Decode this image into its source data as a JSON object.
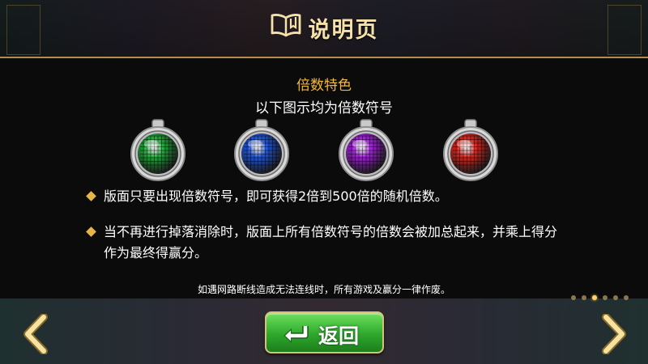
{
  "header": {
    "title": "说明页",
    "icon": "book-icon"
  },
  "content": {
    "section_title": "倍数特色",
    "section_subtitle": "以下图示均为倍数符号",
    "symbols": [
      {
        "name": "green-multiplier-potion",
        "color": "#1fae3a"
      },
      {
        "name": "blue-multiplier-potion",
        "color": "#1f56e0"
      },
      {
        "name": "purple-multiplier-potion",
        "color": "#a51fe0"
      },
      {
        "name": "red-multiplier-potion",
        "color": "#e0261f"
      }
    ],
    "bullets": [
      {
        "line1": "版面只要出现倍数符号，即可获得2倍到500倍的随机倍数。"
      },
      {
        "line1": "当不再进行掉落消除时，版面上所有倍数符号的倍数会被加总起来，并乘上得分",
        "line2": "作为最终得赢分。"
      }
    ],
    "notice": "如遇网路断线造成无法连线时，所有游戏及赢分一律作废。"
  },
  "pagination": {
    "total": 6,
    "active_index": 2
  },
  "controls": {
    "back_label": "返回",
    "prev_icon": "chevron-left-icon",
    "next_icon": "chevron-right-icon"
  },
  "colors": {
    "accent_gold": "#f4b83a",
    "border_gold": "#b58d4b",
    "button_green": "#2ea82c"
  }
}
